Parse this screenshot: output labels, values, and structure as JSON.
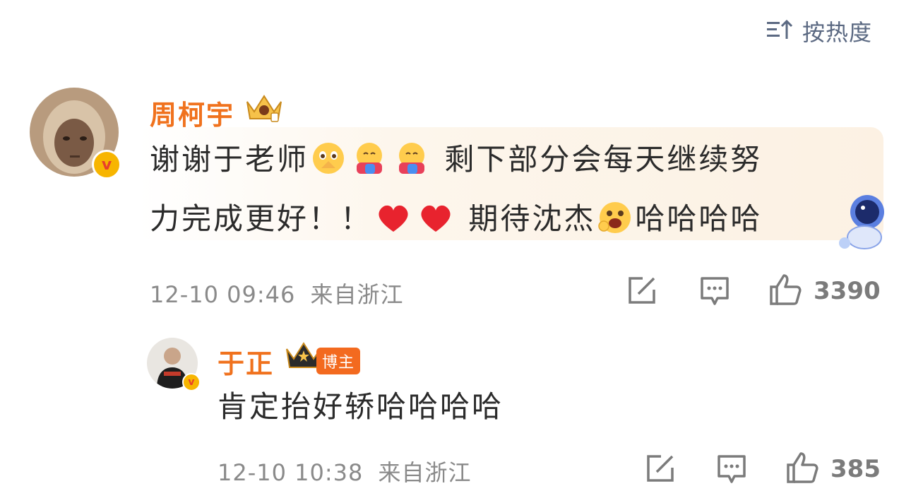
{
  "sort": {
    "label": "按热度",
    "icon": "sort-icon"
  },
  "comments": [
    {
      "username": "周柯宇",
      "line1_a": "谢谢于老师",
      "line1_b": "剩下部分会每天继续努",
      "line2_a": "力完成更好！！",
      "line2_b": "期待沈杰",
      "line2_c": "哈哈哈哈",
      "date": "12-10 09:46",
      "location": "来自浙江",
      "likes": "3390"
    },
    {
      "username": "于正",
      "badge": "博主",
      "text": "肯定抬好轿哈哈哈哈",
      "date": "12-10 10:38",
      "location": "来自浙江",
      "likes": "385"
    }
  ],
  "colors": {
    "username": "#f0721e",
    "meta": "#8a8a8a",
    "icon": "#7b7b7b"
  }
}
